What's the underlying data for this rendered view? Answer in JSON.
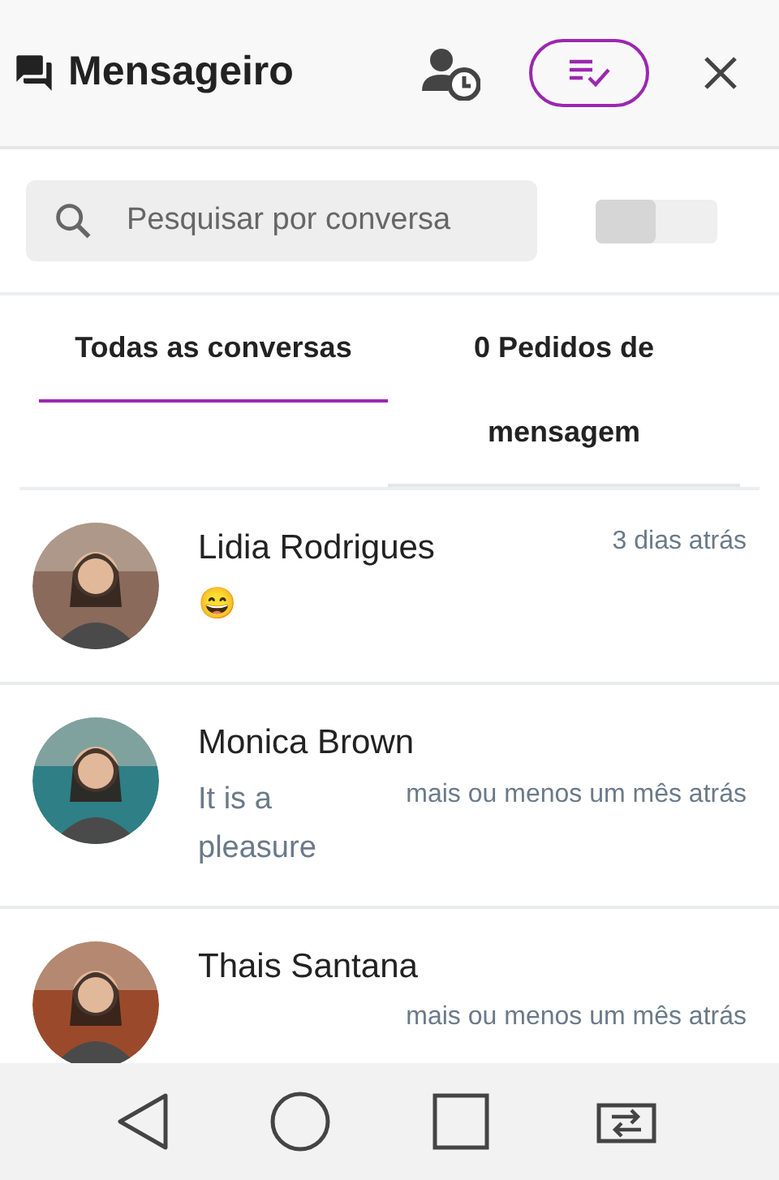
{
  "header": {
    "title": "Mensageiro"
  },
  "search": {
    "placeholder": "Pesquisar por conversa"
  },
  "toggle": {
    "on": false
  },
  "tabs": [
    {
      "label": "Todas as conversas",
      "selected": true
    },
    {
      "label": "0 Pedidos de mensagem",
      "selected": false
    }
  ],
  "conversations": [
    {
      "name": "Lidia Rodrigues",
      "preview": "😄",
      "time": "3 dias atrás",
      "kind": "top",
      "color": "#8a6a5a"
    },
    {
      "name": "Monica Brown",
      "preview": "It is a pleasure",
      "time": "mais ou menos um mês atrás",
      "kind": "bottom",
      "color": "#2f7f86"
    },
    {
      "name": "Thais Santana",
      "time": "mais ou menos um mês atrás",
      "kind": "bottom",
      "color": "#9a4a2a"
    }
  ]
}
